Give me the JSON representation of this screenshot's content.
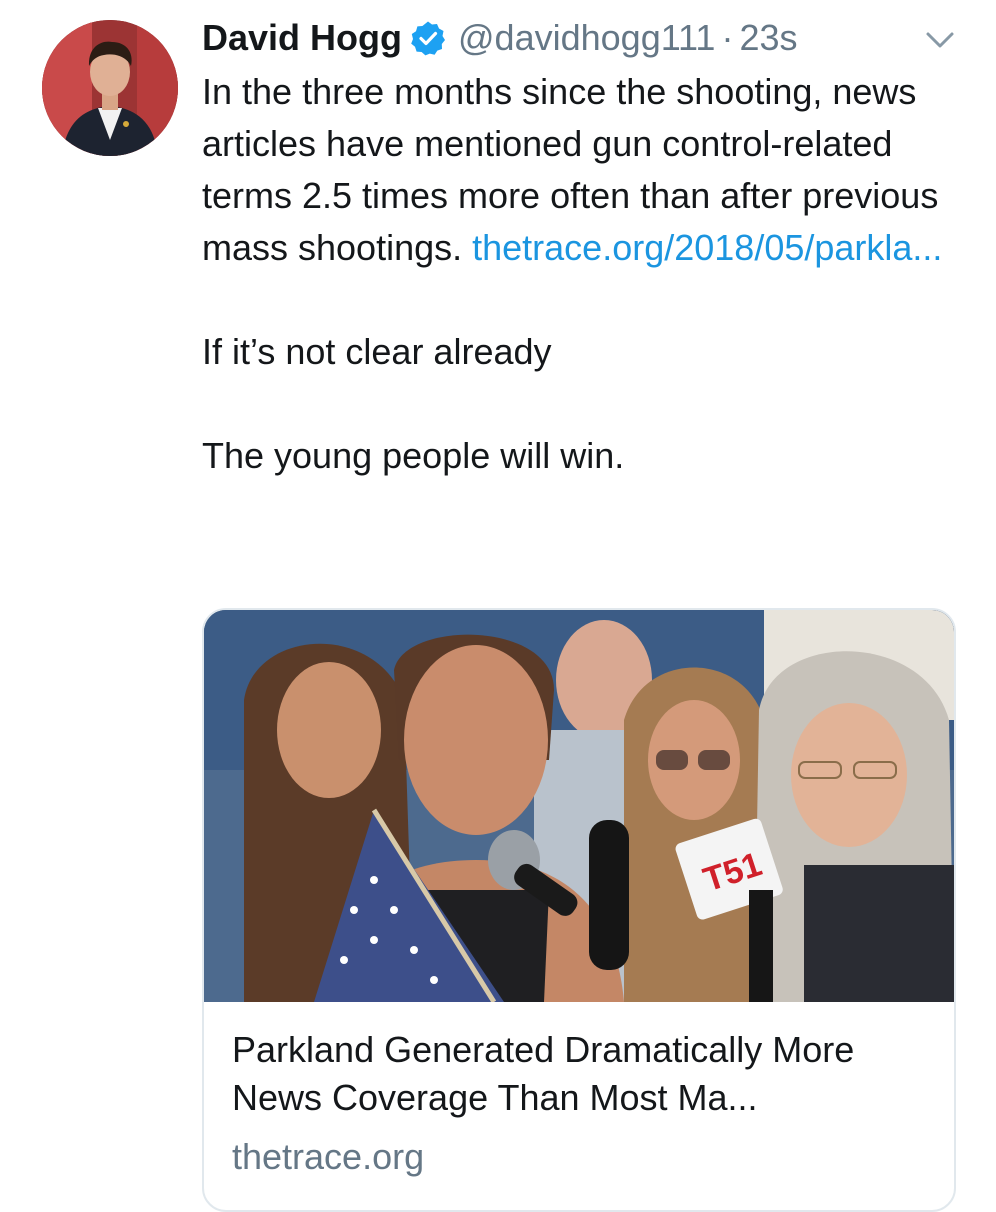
{
  "tweet": {
    "author": {
      "display_name": "David Hogg",
      "handle": "@davidhogg111",
      "verified": true,
      "avatar_icon": "avatar-photo"
    },
    "separator": "·",
    "time": "23s",
    "menu_icon": "chevron-down-icon",
    "text": {
      "paragraph1_main": "In the three months since the shooting, news articles have mentioned gun control-related terms 2.5 times more often than after previous mass shootings. ",
      "paragraph1_link": "thetrace.org/2018/05/parkla...",
      "paragraph2": "If it’s not clear already",
      "paragraph3": "The young people will win."
    },
    "link_card": {
      "image_icon": "news-photo",
      "title": "Parkland Generated Dramatically More News Coverage Than Most Ma...",
      "domain": "thetrace.org"
    }
  },
  "colors": {
    "link": "#1b95e0",
    "secondary_text": "#657786",
    "primary_text": "#14171a",
    "verified_badge": "#1da1f2",
    "card_border": "#e1e8ed"
  }
}
